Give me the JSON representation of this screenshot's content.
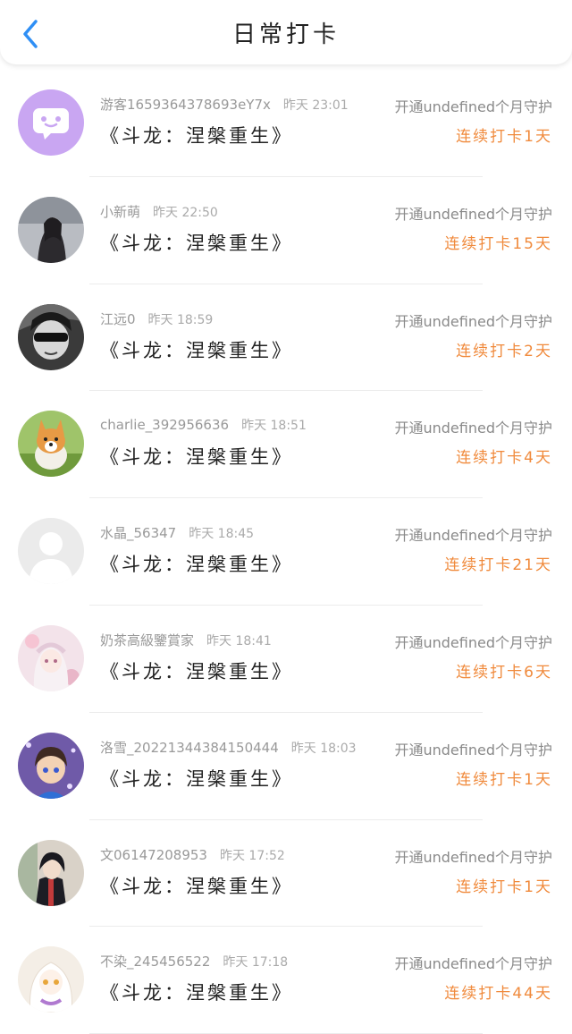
{
  "header": {
    "title": "日常打卡",
    "back_icon": "chevron-left-icon",
    "accent": "#2f8ff5"
  },
  "colors": {
    "streak": "#f08a3c",
    "meta": "#999999",
    "work": "#222222"
  },
  "rows": [
    {
      "name": "游客1659364378693eY7x",
      "time": "昨天 23:01",
      "work": "《斗龙：涅槃重生》",
      "guard": "开通undefined个月守护",
      "streak": "连续打卡1天",
      "avatar_icon": "guest-avatar-icon"
    },
    {
      "name": "小新萌",
      "time": "昨天 22:50",
      "work": "《斗龙：涅槃重生》",
      "guard": "开通undefined个月守护",
      "streak": "连续打卡15天",
      "avatar_icon": "user-avatar-photo"
    },
    {
      "name": "江远0",
      "time": "昨天 18:59",
      "work": "《斗龙：涅槃重生》",
      "guard": "开通undefined个月守护",
      "streak": "连续打卡2天",
      "avatar_icon": "user-avatar-photo"
    },
    {
      "name": "charlie_392956636",
      "time": "昨天 18:51",
      "work": "《斗龙：涅槃重生》",
      "guard": "开通undefined个月守护",
      "streak": "连续打卡4天",
      "avatar_icon": "user-avatar-photo"
    },
    {
      "name": "水晶_56347",
      "time": "昨天 18:45",
      "work": "《斗龙：涅槃重生》",
      "guard": "开通undefined个月守护",
      "streak": "连续打卡21天",
      "avatar_icon": "default-avatar-icon"
    },
    {
      "name": "奶茶高級鑒賞家",
      "time": "昨天 18:41",
      "work": "《斗龙：涅槃重生》",
      "guard": "开通undefined个月守护",
      "streak": "连续打卡6天",
      "avatar_icon": "user-avatar-photo"
    },
    {
      "name": "洛雪_202213443841504​44",
      "time": "昨天 18:03",
      "work": "《斗龙：涅槃重生》",
      "guard": "开通undefined个月守护",
      "streak": "连续打卡1天",
      "avatar_icon": "user-avatar-photo"
    },
    {
      "name": "文06147208953",
      "time": "昨天 17:52",
      "work": "《斗龙：涅槃重生》",
      "guard": "开通undefined个月守护",
      "streak": "连续打卡1天",
      "avatar_icon": "user-avatar-photo"
    },
    {
      "name": "不染_245456522",
      "time": "昨天 17:18",
      "work": "《斗龙：涅槃重生》",
      "guard": "开通undefined个月守护",
      "streak": "连续打卡44天",
      "avatar_icon": "user-avatar-photo"
    }
  ]
}
